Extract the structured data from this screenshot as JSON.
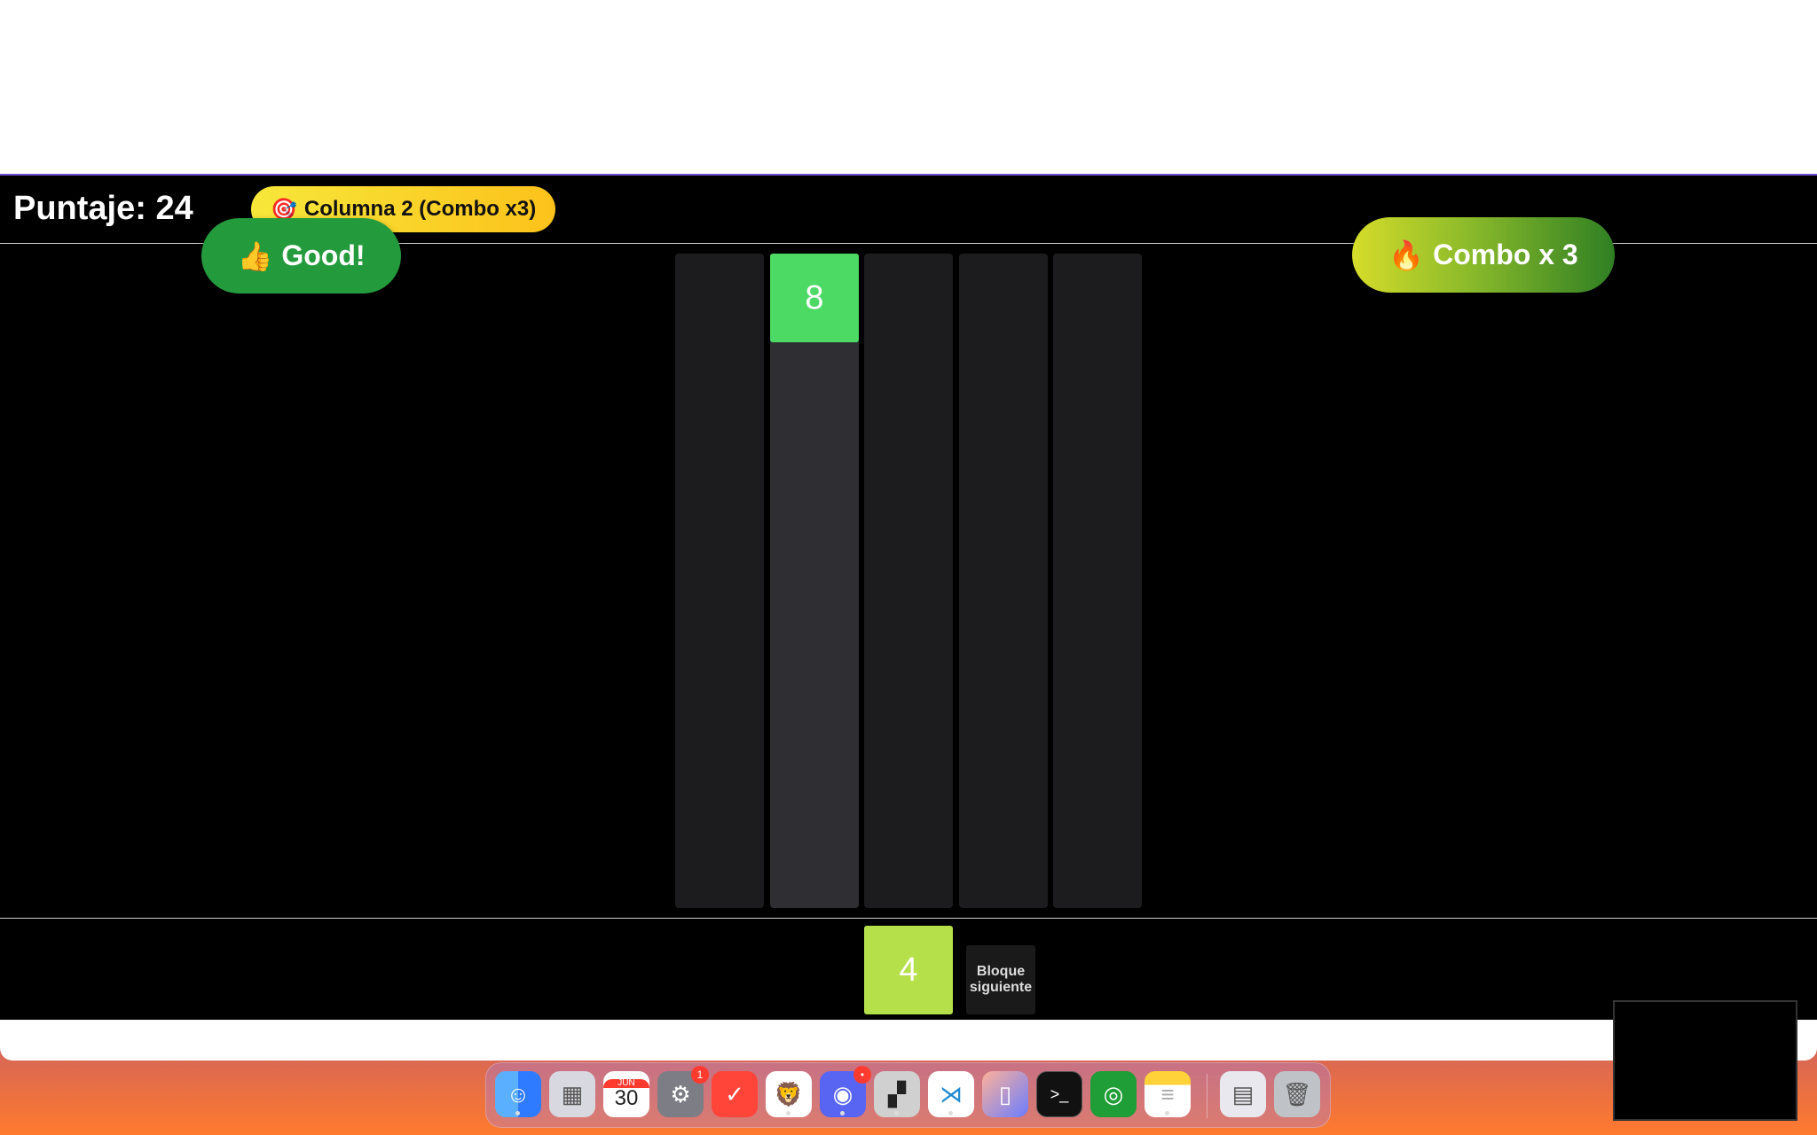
{
  "game": {
    "score_label": "Puntaje: 24",
    "column_badge_icon": "🎯",
    "column_badge_text": "Columna 2 (Combo x3)",
    "good_icon": "👍",
    "good_text": "Good!",
    "combo_icon": "🔥",
    "combo_text": "Combo x 3",
    "board": {
      "columns": 5,
      "active_column": 2,
      "blocks": [
        {
          "column": 2,
          "row": 1,
          "value": "8",
          "color": "#4cd964"
        }
      ]
    },
    "next_block": {
      "value": "4",
      "color": "#b5e04a",
      "label": "Bloque siguiente"
    }
  },
  "dock": {
    "apps": [
      {
        "name": "finder-icon",
        "running": true
      },
      {
        "name": "launchpad-icon",
        "running": false
      },
      {
        "name": "calendar-icon",
        "month": "JUN",
        "day": "30",
        "running": false
      },
      {
        "name": "system-settings-icon",
        "badge": "1",
        "running": false
      },
      {
        "name": "clock-icon",
        "running": false
      },
      {
        "name": "brave-browser-icon",
        "running": true
      },
      {
        "name": "discord-icon",
        "badge": "•",
        "running": true
      },
      {
        "name": "cursor-editor-icon",
        "running": true
      },
      {
        "name": "vscode-icon",
        "running": true
      },
      {
        "name": "simulator-icon",
        "running": false
      },
      {
        "name": "terminal-icon",
        "running": false
      },
      {
        "name": "network-icon",
        "running": false
      },
      {
        "name": "notes-icon",
        "running": true
      },
      {
        "name": "preview-icon",
        "running": false
      },
      {
        "name": "trash-icon",
        "running": false
      }
    ]
  },
  "colors": {
    "accent": "#6b4fd0",
    "good": "#239b3c",
    "badge": "#fcc21b",
    "block": "#4cd964",
    "next": "#b5e04a"
  }
}
